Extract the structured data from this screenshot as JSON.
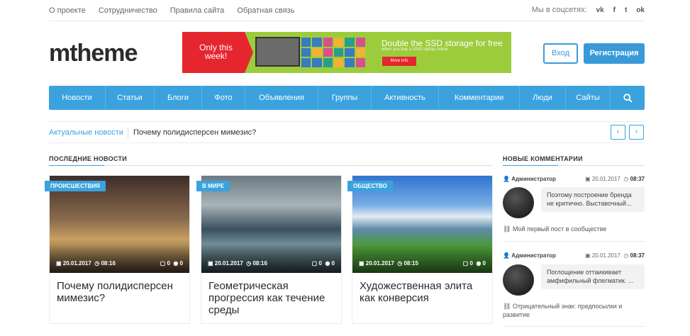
{
  "top_nav": [
    "О проекте",
    "Сотрудничество",
    "Правила сайта",
    "Обратная связь"
  ],
  "social": {
    "label": "Мы в соцсетях:",
    "icons": [
      "vk-icon",
      "facebook-icon",
      "twitter-icon",
      "odnoklassniki-icon"
    ]
  },
  "logo": "mtheme",
  "banner": {
    "promo": "Only this week!",
    "headline": "Double the SSD storage for free",
    "sub": "when you buy a VAIO laptop online",
    "cta": "More info"
  },
  "auth": {
    "login": "Вход",
    "register": "Регистрация"
  },
  "main_nav": [
    "Новости",
    "Статьи",
    "Блоги",
    "Фото",
    "Объявления",
    "Группы",
    "Активность",
    "Комментарии",
    "Люди",
    "Сайты"
  ],
  "ticker": {
    "label": "Актуальные новости",
    "text": "Почему полидисперсен мимезис?"
  },
  "latest": {
    "title": "ПОСЛЕДНИЕ НОВОСТИ",
    "cards": [
      {
        "category": "ПРОИСШЕСТВИЯ",
        "date": "20.01.2017",
        "time": "08:16",
        "comments": "0",
        "views": "0",
        "title": "Почему полидисперсен мимезис?"
      },
      {
        "category": "В МИРЕ",
        "date": "20.01.2017",
        "time": "08:16",
        "comments": "0",
        "views": "0",
        "title": "Геометрическая прогрессия как течение среды"
      },
      {
        "category": "ОБЩЕСТВО",
        "date": "20.01.2017",
        "time": "08:15",
        "comments": "0",
        "views": "0",
        "title": "Художественная элита как конверсия"
      }
    ]
  },
  "comments": {
    "title": "НОВЫЕ КОММЕНТАРИИ",
    "items": [
      {
        "author": "Администратор",
        "date": "20.01.2017",
        "time": "08:37",
        "text": "Поэтому построение бренда не критично. Выставочный...",
        "post": "Мой первый пост в сообществе"
      },
      {
        "author": "Администратор",
        "date": "20.01.2017",
        "time": "08:37",
        "text": "Поглощение оттаикивает амфифильный флегматик. ...",
        "post": "Отрицательный знак: предпосылки и развитие"
      }
    ]
  }
}
